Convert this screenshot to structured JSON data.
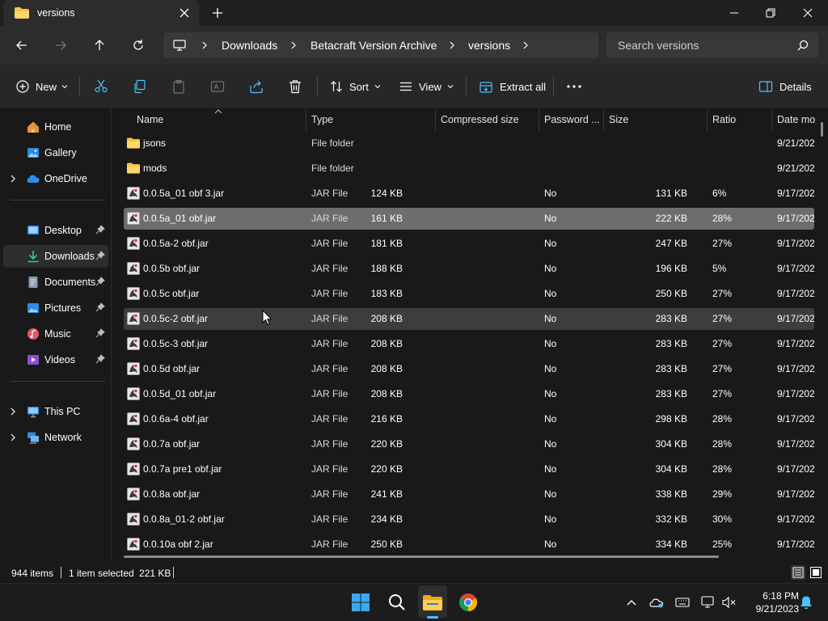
{
  "window": {
    "tab_title": "versions"
  },
  "address": {
    "crumbs": [
      "Downloads",
      "Betacraft Version Archive",
      "versions"
    ],
    "search_placeholder": "Search versions"
  },
  "toolbar": {
    "new_label": "New",
    "sort_label": "Sort",
    "view_label": "View",
    "extract_label": "Extract all",
    "details_label": "Details"
  },
  "sidebar": {
    "items": [
      {
        "label": "Home"
      },
      {
        "label": "Gallery"
      },
      {
        "label": "OneDrive"
      },
      {
        "label": "Desktop"
      },
      {
        "label": "Downloads"
      },
      {
        "label": "Documents"
      },
      {
        "label": "Pictures"
      },
      {
        "label": "Music"
      },
      {
        "label": "Videos"
      },
      {
        "label": "This PC"
      },
      {
        "label": "Network"
      }
    ]
  },
  "columns": {
    "name": "Name",
    "type": "Type",
    "compressed": "Compressed size",
    "password": "Password ...",
    "size": "Size",
    "ratio": "Ratio",
    "date": "Date mo"
  },
  "files": [
    {
      "name": "jsons",
      "type": "File folder",
      "compressed": "",
      "password": "",
      "size": "",
      "ratio": "",
      "date": "9/21/202"
    },
    {
      "name": "mods",
      "type": "File folder",
      "compressed": "",
      "password": "",
      "size": "",
      "ratio": "",
      "date": "9/21/202"
    },
    {
      "name": "0.0.5a_01 obf 3.jar",
      "type": "JAR File",
      "compressed": "124 KB",
      "password": "No",
      "size": "131 KB",
      "ratio": "6%",
      "date": "9/17/202"
    },
    {
      "name": "0.0.5a_01 obf.jar",
      "type": "JAR File",
      "compressed": "161 KB",
      "password": "No",
      "size": "222 KB",
      "ratio": "28%",
      "date": "9/17/202"
    },
    {
      "name": "0.0.5a-2 obf.jar",
      "type": "JAR File",
      "compressed": "181 KB",
      "password": "No",
      "size": "247 KB",
      "ratio": "27%",
      "date": "9/17/202"
    },
    {
      "name": "0.0.5b obf.jar",
      "type": "JAR File",
      "compressed": "188 KB",
      "password": "No",
      "size": "196 KB",
      "ratio": "5%",
      "date": "9/17/202"
    },
    {
      "name": "0.0.5c obf.jar",
      "type": "JAR File",
      "compressed": "183 KB",
      "password": "No",
      "size": "250 KB",
      "ratio": "27%",
      "date": "9/17/202"
    },
    {
      "name": "0.0.5c-2 obf.jar",
      "type": "JAR File",
      "compressed": "208 KB",
      "password": "No",
      "size": "283 KB",
      "ratio": "27%",
      "date": "9/17/202"
    },
    {
      "name": "0.0.5c-3 obf.jar",
      "type": "JAR File",
      "compressed": "208 KB",
      "password": "No",
      "size": "283 KB",
      "ratio": "27%",
      "date": "9/17/202"
    },
    {
      "name": "0.0.5d obf.jar",
      "type": "JAR File",
      "compressed": "208 KB",
      "password": "No",
      "size": "283 KB",
      "ratio": "27%",
      "date": "9/17/202"
    },
    {
      "name": "0.0.5d_01 obf.jar",
      "type": "JAR File",
      "compressed": "208 KB",
      "password": "No",
      "size": "283 KB",
      "ratio": "27%",
      "date": "9/17/202"
    },
    {
      "name": "0.0.6a-4 obf.jar",
      "type": "JAR File",
      "compressed": "216 KB",
      "password": "No",
      "size": "298 KB",
      "ratio": "28%",
      "date": "9/17/202"
    },
    {
      "name": "0.0.7a obf.jar",
      "type": "JAR File",
      "compressed": "220 KB",
      "password": "No",
      "size": "304 KB",
      "ratio": "28%",
      "date": "9/17/202"
    },
    {
      "name": "0.0.7a pre1 obf.jar",
      "type": "JAR File",
      "compressed": "220 KB",
      "password": "No",
      "size": "304 KB",
      "ratio": "28%",
      "date": "9/17/202"
    },
    {
      "name": "0.0.8a obf.jar",
      "type": "JAR File",
      "compressed": "241 KB",
      "password": "No",
      "size": "338 KB",
      "ratio": "29%",
      "date": "9/17/202"
    },
    {
      "name": "0.0.8a_01-2 obf.jar",
      "type": "JAR File",
      "compressed": "234 KB",
      "password": "No",
      "size": "332 KB",
      "ratio": "30%",
      "date": "9/17/202"
    },
    {
      "name": "0.0.10a obf 2.jar",
      "type": "JAR File",
      "compressed": "250 KB",
      "password": "No",
      "size": "334 KB",
      "ratio": "25%",
      "date": "9/17/202"
    }
  ],
  "status": {
    "item_count": "944 items",
    "selection": "1 item selected",
    "selection_size": "221 KB"
  },
  "clock": {
    "time": "6:18 PM",
    "date": "9/21/2023"
  },
  "colors": {
    "accent": "#4cc2ff",
    "folder": "#f4c44e",
    "selected_row": "#6d6d6d"
  }
}
